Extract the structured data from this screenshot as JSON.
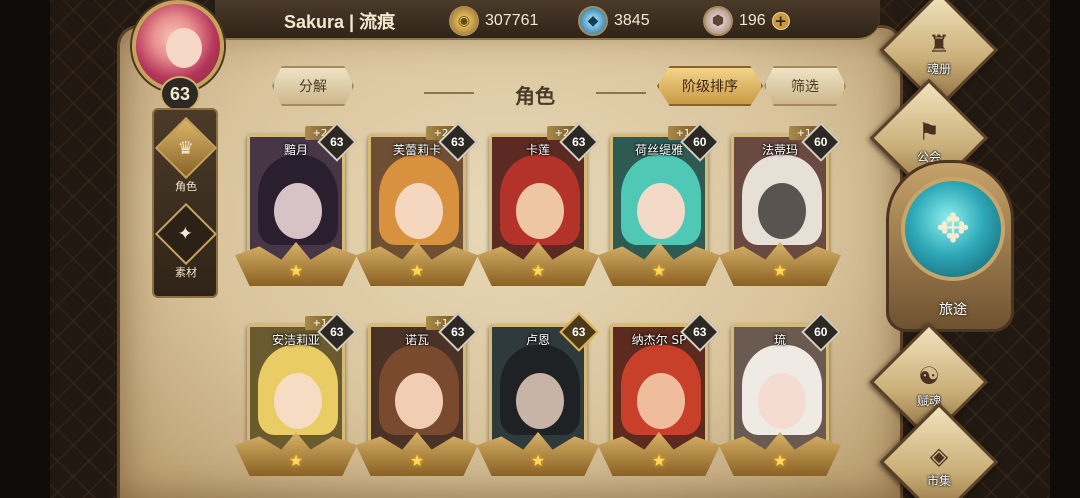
{
  "player": {
    "name": "Sakura | 流痕",
    "level": "63"
  },
  "currencies": [
    {
      "icon": "gold-coin-icon",
      "value": "307761"
    },
    {
      "icon": "crystal-icon",
      "value": "3845"
    },
    {
      "icon": "gem-stone-icon",
      "value": "196"
    }
  ],
  "add_currency_glyph": "+",
  "side_tabs": [
    {
      "label": "角色",
      "icon": "helmet-icon",
      "active": true
    },
    {
      "label": "素材",
      "icon": "creature-icon",
      "active": false
    }
  ],
  "header": {
    "decompose_label": "分解",
    "title": "角色",
    "sort_label": "阶级排序",
    "filter_label": "筛选"
  },
  "heroes": [
    {
      "name": "黯月",
      "level": "63",
      "plus": "+2",
      "hair": "#2a1f2e",
      "face": "#d7c2c6",
      "bg": "#463646"
    },
    {
      "name": "芙蕾莉卡",
      "level": "63",
      "plus": "+2",
      "hair": "#d8913f",
      "face": "#f5d7c0",
      "bg": "#6f4f34"
    },
    {
      "name": "卡莲",
      "level": "63",
      "plus": "+2",
      "hair": "#b3332a",
      "face": "#efc6a4",
      "bg": "#5b2a22"
    },
    {
      "name": "荷丝缇雅",
      "level": "60",
      "plus": "+1",
      "hair": "#4fc9b6",
      "face": "#f3dac8",
      "bg": "#2f5a52"
    },
    {
      "name": "法蒂玛",
      "level": "60",
      "plus": "+1",
      "hair": "#e6e0d6",
      "face": "#5a5450",
      "bg": "#6a4a40"
    },
    {
      "name": "安洁莉亚",
      "level": "63",
      "plus": "+1",
      "hair": "#e9cc63",
      "face": "#f5dcc2",
      "bg": "#6a5a30"
    },
    {
      "name": "诺瓦",
      "level": "63",
      "plus": "+1",
      "hair": "#7a4a2e",
      "face": "#f0cdb3",
      "bg": "#4a3226"
    },
    {
      "name": "卢恩",
      "level": "63",
      "plus": "",
      "hair": "#1f2224",
      "face": "#c7b4a6",
      "bg": "#2f3a3c",
      "gold_level": true
    },
    {
      "name": "纳杰尔 SP",
      "level": "63",
      "plus": "",
      "hair": "#c9402a",
      "face": "#efbd9c",
      "bg": "#5c2a1e"
    },
    {
      "name": "琉",
      "level": "60",
      "plus": "",
      "hair": "#efeae4",
      "face": "#f5dcd0",
      "bg": "#6a5a50"
    }
  ],
  "star_glyph": "★",
  "right_nav": [
    {
      "label": "魂册",
      "icon": "helmet-emblem-icon"
    },
    {
      "label": "公会",
      "icon": "guild-banner-icon"
    },
    {
      "label": "旅途",
      "icon": "journey-compass-icon"
    },
    {
      "label": "赋魂",
      "icon": "soul-flame-icon"
    },
    {
      "label": "市集",
      "icon": "market-gem-icon"
    }
  ]
}
